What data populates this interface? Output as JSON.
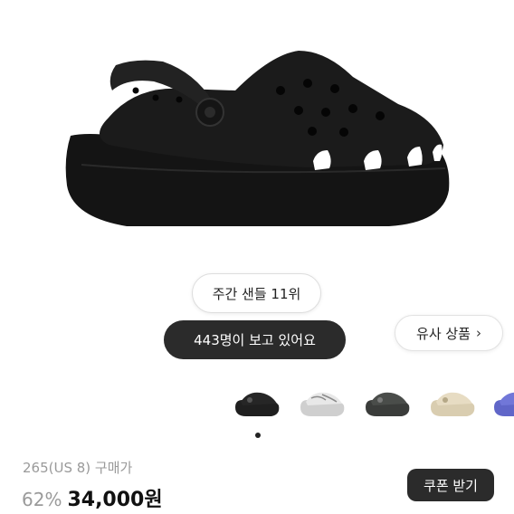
{
  "product": {
    "rank_badge": "주간 샌들 11위",
    "viewers_badge": "443명이 보고 있어요",
    "similar_button": "유사 상품",
    "similar_chevron": "›",
    "size_label": "265(US 8) 구매가",
    "discount": "62%",
    "price": "34,000원",
    "coupon_button": "쿠폰 받기"
  },
  "thumbnails": [
    {
      "name": "thumb-black",
      "color": "#1f1f1f",
      "sole": "#1f1f1f"
    },
    {
      "name": "thumb-marble",
      "color": "#e8e8e8",
      "sole": "#cfcfcf"
    },
    {
      "name": "thumb-gray",
      "color": "#4a4d4a",
      "sole": "#3a3c3a"
    },
    {
      "name": "thumb-beige",
      "color": "#e7dcc3",
      "sole": "#d9cdb0"
    },
    {
      "name": "thumb-purple",
      "color": "#7177d8",
      "sole": "#6066c8"
    }
  ],
  "colors": {
    "dark_pill": "#2b2b2b",
    "shoe": "#1b1b1b"
  }
}
